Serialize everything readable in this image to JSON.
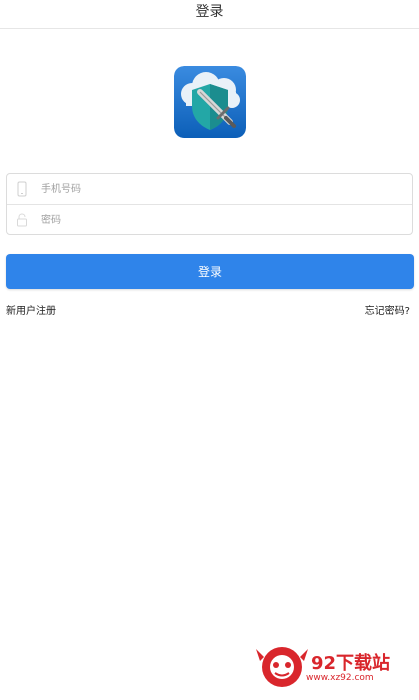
{
  "header": {
    "title": "登录"
  },
  "logo": {
    "icon": "shield-sword-cloud-icon"
  },
  "form": {
    "phone_placeholder": "手机号码",
    "password_placeholder": "密码"
  },
  "actions": {
    "login_label": "登录",
    "register_label": "新用户注册",
    "forgot_label": "忘记密码?"
  },
  "watermark": {
    "text": "92下载站",
    "url": "www.xz92.com"
  },
  "colors": {
    "accent": "#2f84ea",
    "watermark": "#d9262c"
  }
}
